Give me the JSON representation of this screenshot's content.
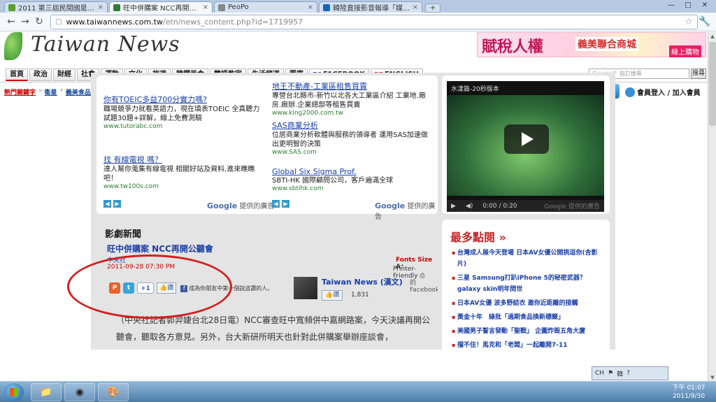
{
  "browser": {
    "tabs": [
      {
        "label": "2011 第三屆民間國是論壇",
        "active": false,
        "fav": "#5aa02c"
      },
      {
        "label": "旺中併購案 NCC再開公聽會",
        "active": true,
        "fav": "#2e7d32"
      },
      {
        "label": "PeoPo",
        "active": false,
        "fav": "#888888"
      },
      {
        "label": "韓陸直接影音報導「媒體巨",
        "active": false,
        "fav": "#1565c0"
      }
    ],
    "new_tab": "+",
    "url_host": "www.taiwannews.com.tw",
    "url_path": "/etn/news_content.php?id=1719957"
  },
  "site": {
    "logo": "Taiwan News",
    "banner_ad": {
      "main": "賦稅人權",
      "sub": "義美聯合商城",
      "tag": "線上購物"
    },
    "nav": [
      {
        "label": "首頁",
        "kind": "text"
      },
      {
        "label": "政治",
        "kind": "text"
      },
      {
        "label": "財經",
        "kind": "text"
      },
      {
        "label": "社會",
        "kind": "text"
      },
      {
        "label": "運動",
        "kind": "text"
      },
      {
        "label": "文化",
        "kind": "text"
      },
      {
        "label": "旅遊",
        "kind": "text"
      },
      {
        "label": "精饌美食",
        "kind": "text"
      },
      {
        "label": "雙語教室",
        "kind": "text"
      },
      {
        "label": "生活頻道",
        "kind": "text"
      },
      {
        "label": "圖庫",
        "kind": "text"
      },
      {
        "label": "FACEBOOK",
        "kind": "fb"
      },
      {
        "label": "ENGLISH",
        "kind": "en"
      }
    ],
    "google_search_placeholder": "Google™ 自訂搜尋",
    "google_search_button": "搜尋",
    "hot_keywords": {
      "label": "熱門關鍵字",
      "items": [
        "衛星",
        "義美食品",
        "F-16",
        "ECFA",
        "google",
        "美食",
        "facebook",
        "九二共識",
        "iphone",
        "賽德克巴萊"
      ],
      "more": "更多關鍵字 »"
    },
    "search_button": "search",
    "member": "會員登入 / 加入會員"
  },
  "ads": {
    "left": [
      {
        "title": "你有TOEIC多益700分實力嗎?",
        "desc": "職場競爭力就看英語力，現在填表TOEIC 全真聽力試題30題+詳解，線上免費測驗",
        "url": "www.tutorabc.com"
      },
      {
        "title": "找 有線電視 嗎？",
        "desc": "達人幫你蒐集有線電視 相關好站及資料,進來瞧瞧吧！",
        "url": "www.tw100s.com"
      }
    ],
    "right": [
      {
        "title": "地王不動產-工業區租售買賣",
        "desc": "專營台北縣市-新竹以北各大工業區介紹 工業地.廠房.廠辦.企業總部等租售買賣",
        "url": "www.king2000.com.tw"
      },
      {
        "title": "SAS商業分析",
        "desc": "位居商業分析軟體與服務的領導者 運用SAS加速做出更明智的決策",
        "url": "www.SAS.com"
      },
      {
        "title": "Global Six Sigma Prof.",
        "desc": "SBTI-HK 國際顧問公司，客戶遍滿全球",
        "url": "www.sbtihk.com"
      }
    ],
    "google_label": "Google",
    "google_suffix": "提供的廣告"
  },
  "video": {
    "title": "水漾篇-20秒版本",
    "time": "0:00 / 0:20",
    "brand": "Google 提供的廣告"
  },
  "article": {
    "section": "影劇新聞",
    "headline": "旺中併購案 NCC再開公聽會",
    "source": "中央社",
    "date": "2011-09-28 07:30 PM",
    "font_size": "Fonts Size",
    "printer": "Printer-Friendly",
    "share_like": "讚",
    "share_text": "成為你朋友中第一個說這讚的人。",
    "fb_page_name": "Taiwan News (漢文)",
    "fb_page_on": "的 Facebook",
    "fb_like": "讚",
    "fb_count": "1,831",
    "body": "（中央社記者郭羿婕台北28日電）NCC審查旺中寬頻併中嘉網路案，今天決議再開公聽會，聽取各方意見。另外，台大新研所明天也針對此併購案舉辦座談會，"
  },
  "popular": {
    "title": "最多點閱 »",
    "items": [
      "台灣成人展今天登場 日本AV女優公開挑逗你(含影片)",
      "三星 Samsung打趴iPhone 5的秘密武器？ galaxy skin明年問世",
      "日本AV女優 波多野結衣 邀你近距離的接觸",
      "黃金十年　綠批「過期食品換新標籤」",
      "美國男子誓言發動「聖戰」 企圖炸毀五角大廈",
      "擋不住！馬克和「老闆」一起離開7-11"
    ]
  },
  "taskbar": {
    "tray": [
      "CH",
      "⚑",
      "韓",
      "?"
    ],
    "time": "下午 01:07",
    "date": "2011/9/30"
  }
}
